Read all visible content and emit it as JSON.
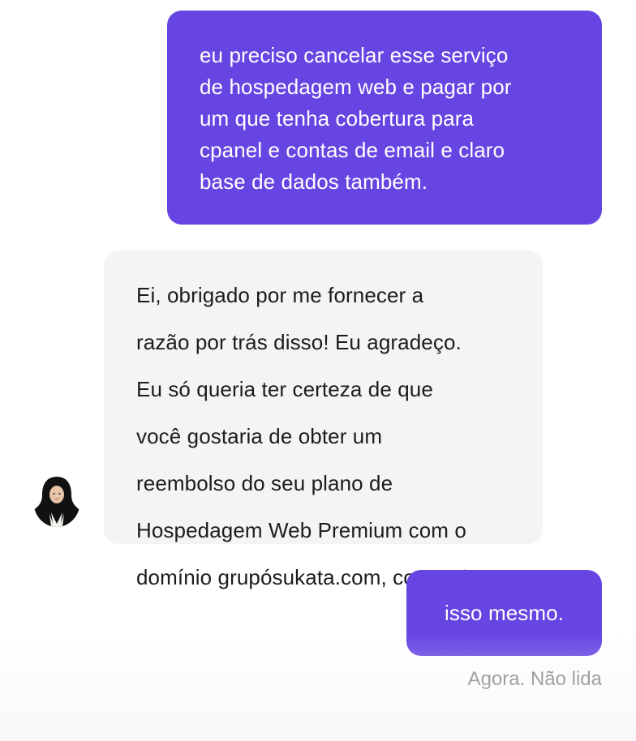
{
  "conversation": {
    "messages": [
      {
        "sender": "user",
        "lines": [
          "eu preciso cancelar esse serviço",
          "de hospedagem web e pagar por",
          "um que tenha cobertura para",
          "cpanel e contas de email e claro",
          "base de dados também."
        ]
      },
      {
        "sender": "agent",
        "paragraphs": [
          {
            "lines": [
              "Ei, obrigado por me fornecer a",
              "razão por trás disso! Eu agradeço."
            ]
          },
          {
            "lines": [
              "Eu só queria ter certeza de que",
              "você gostaria de obter um",
              "reembolso do seu plano de",
              "Hospedagem Web Premium com o",
              "domínio grupósukata.com, correto?"
            ]
          }
        ]
      },
      {
        "sender": "user",
        "text": "isso mesmo."
      }
    ],
    "status": "Agora. Não lida"
  },
  "colors": {
    "outgoing_bubble": "#6645e2",
    "incoming_bubble": "#f4f4f4",
    "status_text": "#7a7a7a"
  },
  "icons": {
    "avatar": "agent-avatar-photo"
  }
}
